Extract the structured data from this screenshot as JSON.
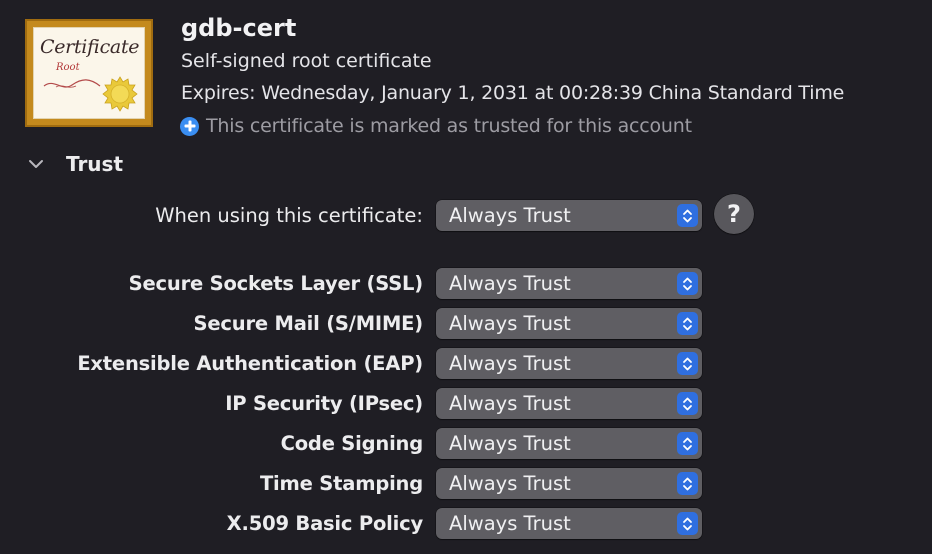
{
  "certificate": {
    "name": "gdb-cert",
    "kind": "Self-signed root certificate",
    "expires": "Expires: Wednesday, January 1, 2031 at 00:28:39 China Standard Time",
    "trusted_notice": "This certificate is marked as trusted for this account",
    "trusted_icon": "plus-circle-icon",
    "icon": {
      "title": "Certificate",
      "subtitle": "Root"
    }
  },
  "trust": {
    "section_title": "Trust",
    "expanded": true,
    "when_using": {
      "label": "When using this certificate:",
      "value": "Always Trust"
    },
    "help_label": "?",
    "policies": [
      {
        "label": "Secure Sockets Layer (SSL)",
        "value": "Always Trust"
      },
      {
        "label": "Secure Mail (S/MIME)",
        "value": "Always Trust"
      },
      {
        "label": "Extensible Authentication (EAP)",
        "value": "Always Trust"
      },
      {
        "label": "IP Security (IPsec)",
        "value": "Always Trust"
      },
      {
        "label": "Code Signing",
        "value": "Always Trust"
      },
      {
        "label": "Time Stamping",
        "value": "Always Trust"
      },
      {
        "label": "X.509 Basic Policy",
        "value": "Always Trust"
      }
    ]
  },
  "colors": {
    "background": "#1f1e24",
    "popup": "#5f5e63",
    "accent": "#2f6fe0",
    "info_blue": "#3a8ef2",
    "secondary_text": "#9d9ca3",
    "certificate_frame": "#c48a1d"
  }
}
